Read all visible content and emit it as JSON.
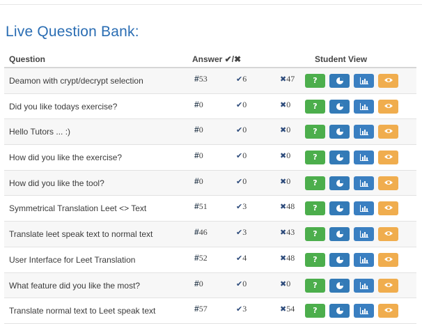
{
  "title": "Live Question Bank:",
  "headers": {
    "question": "Question",
    "answer": "Answer ✔/✖",
    "student_view": "Student View"
  },
  "buttons": {
    "help": "?"
  },
  "rows": [
    {
      "question": "Deamon with crypt/decrypt selection",
      "answers": "53",
      "correct": "6",
      "wrong": "47"
    },
    {
      "question": "Did you like todays exercise?",
      "answers": "0",
      "correct": "0",
      "wrong": "0"
    },
    {
      "question": "Hello Tutors ... :)",
      "answers": "0",
      "correct": "0",
      "wrong": "0"
    },
    {
      "question": "How did you like the exercise?",
      "answers": "0",
      "correct": "0",
      "wrong": "0"
    },
    {
      "question": "How did you like the tool?",
      "answers": "0",
      "correct": "0",
      "wrong": "0"
    },
    {
      "question": "Symmetrical Translation Leet <> Text",
      "answers": "51",
      "correct": "3",
      "wrong": "48"
    },
    {
      "question": "Translate leet speak text to normal text",
      "answers": "46",
      "correct": "3",
      "wrong": "43"
    },
    {
      "question": "User Interface for Leet Translation",
      "answers": "52",
      "correct": "4",
      "wrong": "48"
    },
    {
      "question": "What feature did you like the most?",
      "answers": "0",
      "correct": "0",
      "wrong": "0"
    },
    {
      "question": "Translate normal text to Leet speak text",
      "answers": "57",
      "correct": "3",
      "wrong": "54"
    }
  ],
  "colors": {
    "title": "#2a6db3",
    "help_button": "#4cae4c",
    "stats_button": "#337ab7",
    "chart_button": "#3a7fc1",
    "view_button": "#f0ad4e"
  },
  "icons": {
    "answers": "hash-icon",
    "correct": "check-icon",
    "wrong": "x-icon",
    "help": "question-icon",
    "stats": "pie-chart-icon",
    "chart": "bar-chart-icon",
    "view": "eye-icon"
  }
}
